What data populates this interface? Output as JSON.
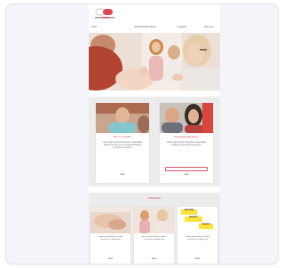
{
  "nav": {
    "items": [
      "Start",
      "Bildbibliothek Berlin",
      "Angebot",
      "Über uns"
    ]
  },
  "cards": [
    {
      "title": "Ben mi verliebt?",
      "text": "Lorem ipsum dolor sit amet, consectetur adipiscing elit, sed do eiusmod tempor incididunt ut labore",
      "button": "MEHR"
    },
    {
      "title": "Haushaltungsberatung",
      "text": "Lorem ipsum dolor sit amet, consectetur adipiscing elit sed do eiusmod",
      "input_placeholder": "",
      "button": "MEHR"
    }
  ],
  "news": {
    "title": "Aktuelles",
    "items": [
      {
        "text": "Lorem ipsum dolor sit amet consectetur adipiscing",
        "button": "MEHR"
      },
      {
        "text": "Lorem ipsum dolor sit amet consectetur adipiscing",
        "button": "MEHR"
      },
      {
        "text": "Lorem ipsum dolor sit amet consectetur adipiscing",
        "button": "MEHR"
      }
    ],
    "stickers": [
      "DEIN KIND",
      "ANGEBOT",
      "FRAGEN?"
    ]
  },
  "colors": {
    "accent": "#d23a4a",
    "section_bg": "#ececec",
    "frame_bg": "#f3f5fa"
  }
}
